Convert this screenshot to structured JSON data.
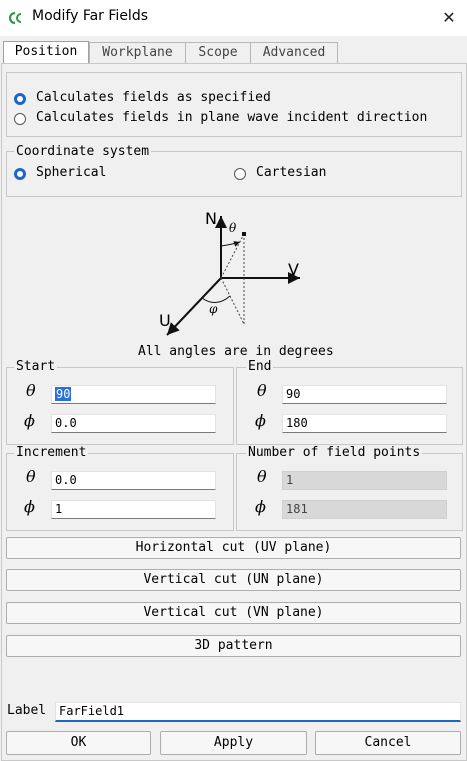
{
  "window": {
    "title": "Modify Far Fields",
    "close_glyph": "✕"
  },
  "tabs": [
    {
      "label": "Position",
      "active": true
    },
    {
      "label": "Workplane",
      "active": false
    },
    {
      "label": "Scope",
      "active": false
    },
    {
      "label": "Advanced",
      "active": false
    }
  ],
  "mode": {
    "options": [
      {
        "label": "Calculates fields as specified",
        "selected": true
      },
      {
        "label": "Calculates fields in plane wave incident direction",
        "selected": false
      }
    ]
  },
  "coordinate_system": {
    "title": "Coordinate system",
    "options": [
      {
        "label": "Spherical",
        "selected": true
      },
      {
        "label": "Cartesian",
        "selected": false
      }
    ]
  },
  "diagram": {
    "axis_n": "N",
    "axis_v": "V",
    "axis_u": "U",
    "theta": "θ",
    "phi": "φ",
    "caption": "All angles are in degrees"
  },
  "symbols": {
    "theta": "θ",
    "phi": "ϕ"
  },
  "start": {
    "title": "Start",
    "theta": "90",
    "phi": "0.0"
  },
  "end": {
    "title": "End",
    "theta": "90",
    "phi": "180"
  },
  "increment": {
    "title": "Increment",
    "theta": "0.0",
    "phi": "1"
  },
  "field_points": {
    "title": "Number of field points",
    "theta": "1",
    "phi": "181"
  },
  "cut_buttons": [
    "Horizontal cut (UV plane)",
    "Vertical cut (UN plane)",
    "Vertical cut (VN plane)",
    "3D pattern"
  ],
  "label_field": {
    "label": "Label",
    "value": "FarField1"
  },
  "footer": {
    "ok": "OK",
    "apply": "Apply",
    "cancel": "Cancel"
  },
  "colors": {
    "accent": "#1f64c8",
    "background": "#f0f0f0"
  }
}
